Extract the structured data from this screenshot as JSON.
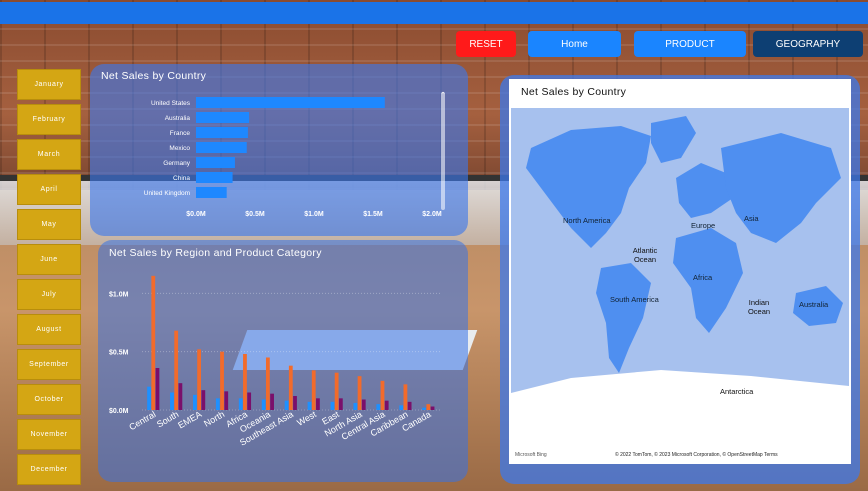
{
  "nav": {
    "reset_label": "RESET",
    "home_label": "Home",
    "product_label": "PRODUCT",
    "geography_label": "GEOGRAPHY"
  },
  "months": [
    "January",
    "February",
    "March",
    "April",
    "May",
    "June",
    "July",
    "August",
    "September",
    "October",
    "November",
    "December"
  ],
  "country_chart": {
    "title": "Net Sales by Country",
    "chart_data": {
      "type": "bar",
      "orientation": "horizontal",
      "categories": [
        "United States",
        "Australia",
        "France",
        "Mexico",
        "Germany",
        "China",
        "United Kingdom"
      ],
      "values": [
        1.6,
        0.45,
        0.44,
        0.43,
        0.33,
        0.31,
        0.26
      ],
      "unit": "M",
      "xlim": [
        0,
        2.0
      ],
      "xticks": [
        "$0.0M",
        "$0.5M",
        "$1.0M",
        "$1.5M",
        "$2.0M"
      ],
      "color": "#1e88ff"
    }
  },
  "region_chart": {
    "title": "Net Sales by Region and Product Category",
    "chart_data": {
      "type": "bar",
      "categories": [
        "Central",
        "South",
        "EMEA",
        "North",
        "Africa",
        "Oceania",
        "Southeast Asia",
        "West",
        "East",
        "North Asia",
        "Central Asia",
        "Caribbean",
        "Canada"
      ],
      "series": [
        {
          "values": [
            0.2,
            0.15,
            0.13,
            0.1,
            0.1,
            0.09,
            0.08,
            0.07,
            0.07,
            0.06,
            0.05,
            0.04,
            0.02
          ],
          "color": "#1e90ff"
        },
        {
          "values": [
            1.15,
            0.68,
            0.52,
            0.5,
            0.48,
            0.45,
            0.38,
            0.34,
            0.32,
            0.29,
            0.25,
            0.22,
            0.05
          ],
          "color": "#f26b2b"
        },
        {
          "values": [
            0.36,
            0.23,
            0.17,
            0.16,
            0.15,
            0.14,
            0.12,
            0.1,
            0.1,
            0.09,
            0.08,
            0.07,
            0.03
          ],
          "color": "#7a0f6b"
        }
      ],
      "ylim": [
        0,
        1.2
      ],
      "yticks": [
        "$0.0M",
        "$0.5M",
        "$1.0M"
      ],
      "grid": true
    }
  },
  "map_panel": {
    "title": "Net Sales by Country",
    "labels": {
      "north_america": "North America",
      "europe": "Europe",
      "asia": "Asia",
      "atlantic": "Atlantic Ocean",
      "africa": "Africa",
      "south_america": "South America",
      "indian": "Indian Ocean",
      "australia": "Australia",
      "antarctica": "Antarctica"
    },
    "logo_text": "Microsoft Bing",
    "attribution": "© 2022 TomTom, © 2023 Microsoft Corporation, © OpenStreetMap  Terms"
  }
}
